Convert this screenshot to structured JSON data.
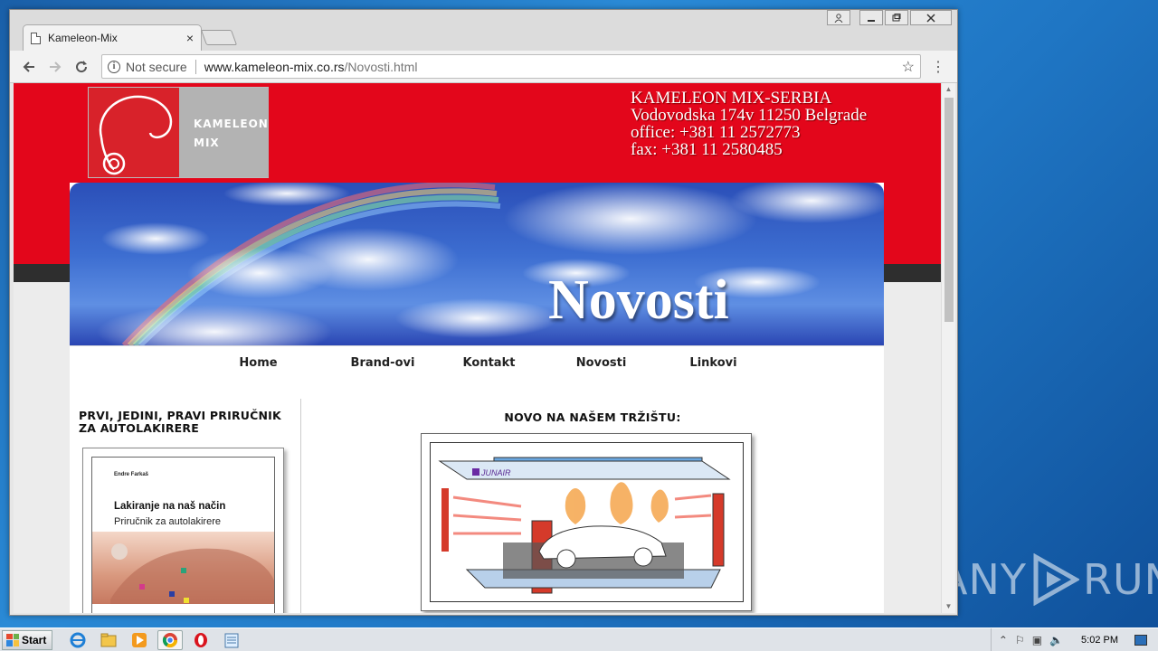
{
  "browser": {
    "tab_title": "Kameleon-Mix",
    "tab_close": "×",
    "security_label": "Not secure",
    "url_host": "www.kameleon-mix.co.rs",
    "url_path": "/Novosti.html"
  },
  "header": {
    "logo_line1": "KAMELEON",
    "logo_line2": "MIX",
    "company_name": "KAMELEON MIX-SERBIA",
    "address": "Vodovodska 174v 11250 Belgrade",
    "office": "office: +381 11 2572773",
    "fax": "fax: +381 11 2580485",
    "colors": {
      "brand_red": "#e3061b",
      "strip": "#2e2e2e"
    }
  },
  "banner": {
    "title": "Novosti"
  },
  "nav": {
    "items": [
      {
        "label": "Home"
      },
      {
        "label": "Brand-ovi"
      },
      {
        "label": "Kontakt"
      },
      {
        "label": "Novosti"
      },
      {
        "label": "Linkovi"
      }
    ]
  },
  "sidebar": {
    "heading": "PRVI, JEDINI, PRAVI PRIRUČNIK ZA AUTOLAKIRERE",
    "book": {
      "author": "Endre Farkaš",
      "title": "Lakiranje na naš način",
      "subtitle": "Priručnik za autolakirere"
    }
  },
  "main": {
    "heading": "NOVO NA NAŠEM TRŽIŠTU:",
    "booth_brand": "JUNAIR"
  },
  "desktop": {
    "watermark_left": "ANY",
    "watermark_right": "RUN"
  },
  "taskbar": {
    "start_label": "Start",
    "clock": "5:02 PM",
    "icons": [
      "internet-explorer-icon",
      "folder-icon",
      "media-player-icon",
      "chrome-icon",
      "opera-icon",
      "notepad-icon"
    ]
  }
}
